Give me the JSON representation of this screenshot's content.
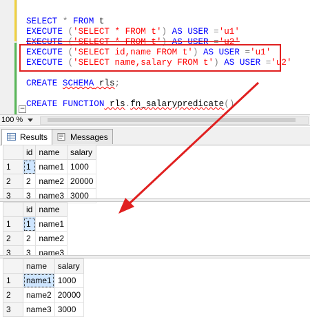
{
  "editor": {
    "lines": [
      {
        "parts": [
          {
            "t": "SELECT",
            "c": "kw"
          },
          {
            "t": " ",
            "c": "plain"
          },
          {
            "t": "*",
            "c": "op"
          },
          {
            "t": " ",
            "c": "plain"
          },
          {
            "t": "FROM",
            "c": "kw"
          },
          {
            "t": " t",
            "c": "plain"
          }
        ]
      },
      {
        "parts": [
          {
            "t": "EXECUTE",
            "c": "kw"
          },
          {
            "t": " ",
            "c": "plain"
          },
          {
            "t": "(",
            "c": "op"
          },
          {
            "t": "'SELECT * FROM t'",
            "c": "str"
          },
          {
            "t": ")",
            "c": "op"
          },
          {
            "t": " ",
            "c": "plain"
          },
          {
            "t": "AS",
            "c": "kw"
          },
          {
            "t": " ",
            "c": "plain"
          },
          {
            "t": "USER",
            "c": "kw"
          },
          {
            "t": " ",
            "c": "plain"
          },
          {
            "t": "=",
            "c": "op"
          },
          {
            "t": "'u1'",
            "c": "str"
          }
        ]
      },
      {
        "parts": [
          {
            "t": "EXECUTE",
            "c": "kw"
          },
          {
            "t": " ",
            "c": "plain"
          },
          {
            "t": "(",
            "c": "op"
          },
          {
            "t": "'SELECT * FROM t'",
            "c": "str"
          },
          {
            "t": ")",
            "c": "op"
          },
          {
            "t": " ",
            "c": "plain"
          },
          {
            "t": "AS",
            "c": "kw"
          },
          {
            "t": " ",
            "c": "plain"
          },
          {
            "t": "USER",
            "c": "kw"
          },
          {
            "t": " ",
            "c": "plain"
          },
          {
            "t": "=",
            "c": "op"
          },
          {
            "t": "'u2'",
            "c": "str"
          }
        ]
      },
      {
        "parts": [
          {
            "t": "EXECUTE",
            "c": "kw"
          },
          {
            "t": " ",
            "c": "plain"
          },
          {
            "t": "(",
            "c": "op"
          },
          {
            "t": "'SELECT id,name FROM t'",
            "c": "str"
          },
          {
            "t": ")",
            "c": "op"
          },
          {
            "t": " ",
            "c": "plain"
          },
          {
            "t": "AS",
            "c": "kw"
          },
          {
            "t": " ",
            "c": "plain"
          },
          {
            "t": "USER",
            "c": "kw"
          },
          {
            "t": " ",
            "c": "plain"
          },
          {
            "t": "=",
            "c": "op"
          },
          {
            "t": "'u1'",
            "c": "str"
          }
        ]
      },
      {
        "parts": [
          {
            "t": "EXECUTE",
            "c": "kw"
          },
          {
            "t": " ",
            "c": "plain"
          },
          {
            "t": "(",
            "c": "op"
          },
          {
            "t": "'SELECT name,salary FROM t'",
            "c": "str"
          },
          {
            "t": ")",
            "c": "op"
          },
          {
            "t": " ",
            "c": "plain"
          },
          {
            "t": "AS",
            "c": "kw"
          },
          {
            "t": " ",
            "c": "plain"
          },
          {
            "t": "USER",
            "c": "kw"
          },
          {
            "t": " ",
            "c": "plain"
          },
          {
            "t": "=",
            "c": "op"
          },
          {
            "t": "'u2'",
            "c": "str"
          }
        ]
      },
      {
        "parts": []
      },
      {
        "parts": [
          {
            "t": "CREATE",
            "c": "kw"
          },
          {
            "t": " ",
            "c": "plain"
          },
          {
            "t": "SCHEMA",
            "c": "kw"
          },
          {
            "t": " rls",
            "c": "plain"
          },
          {
            "t": ";",
            "c": "op"
          }
        ]
      },
      {
        "parts": []
      },
      {
        "parts": [
          {
            "t": "CREATE",
            "c": "kw"
          },
          {
            "t": " ",
            "c": "plain"
          },
          {
            "t": "FUNCTION",
            "c": "kw"
          },
          {
            "t": " rls",
            "c": "plain"
          },
          {
            "t": ".",
            "c": "op"
          },
          {
            "t": "fn_salarypredicate",
            "c": "plain"
          },
          {
            "t": "()",
            "c": "op"
          }
        ]
      }
    ],
    "collapse_symbol": "−"
  },
  "zoombar": {
    "zoom_value": "100 %"
  },
  "tabs": {
    "results_label": "Results",
    "messages_label": "Messages"
  },
  "grids": [
    {
      "columns": [
        "id",
        "name",
        "salary"
      ],
      "rows": [
        [
          "1",
          "name1",
          "1000"
        ],
        [
          "2",
          "name2",
          "20000"
        ],
        [
          "3",
          "name3",
          "3000"
        ]
      ]
    },
    {
      "columns": [
        "id",
        "name"
      ],
      "rows": [
        [
          "1",
          "name1"
        ],
        [
          "2",
          "name2"
        ],
        [
          "3",
          "name3"
        ]
      ]
    },
    {
      "columns": [
        "name",
        "salary"
      ],
      "rows": [
        [
          "name1",
          "1000"
        ],
        [
          "name2",
          "20000"
        ],
        [
          "name3",
          "3000"
        ]
      ]
    }
  ],
  "colors": {
    "annotation_red": "#e02020",
    "keyword_blue": "#0000ff",
    "string_red": "#ff0000"
  }
}
